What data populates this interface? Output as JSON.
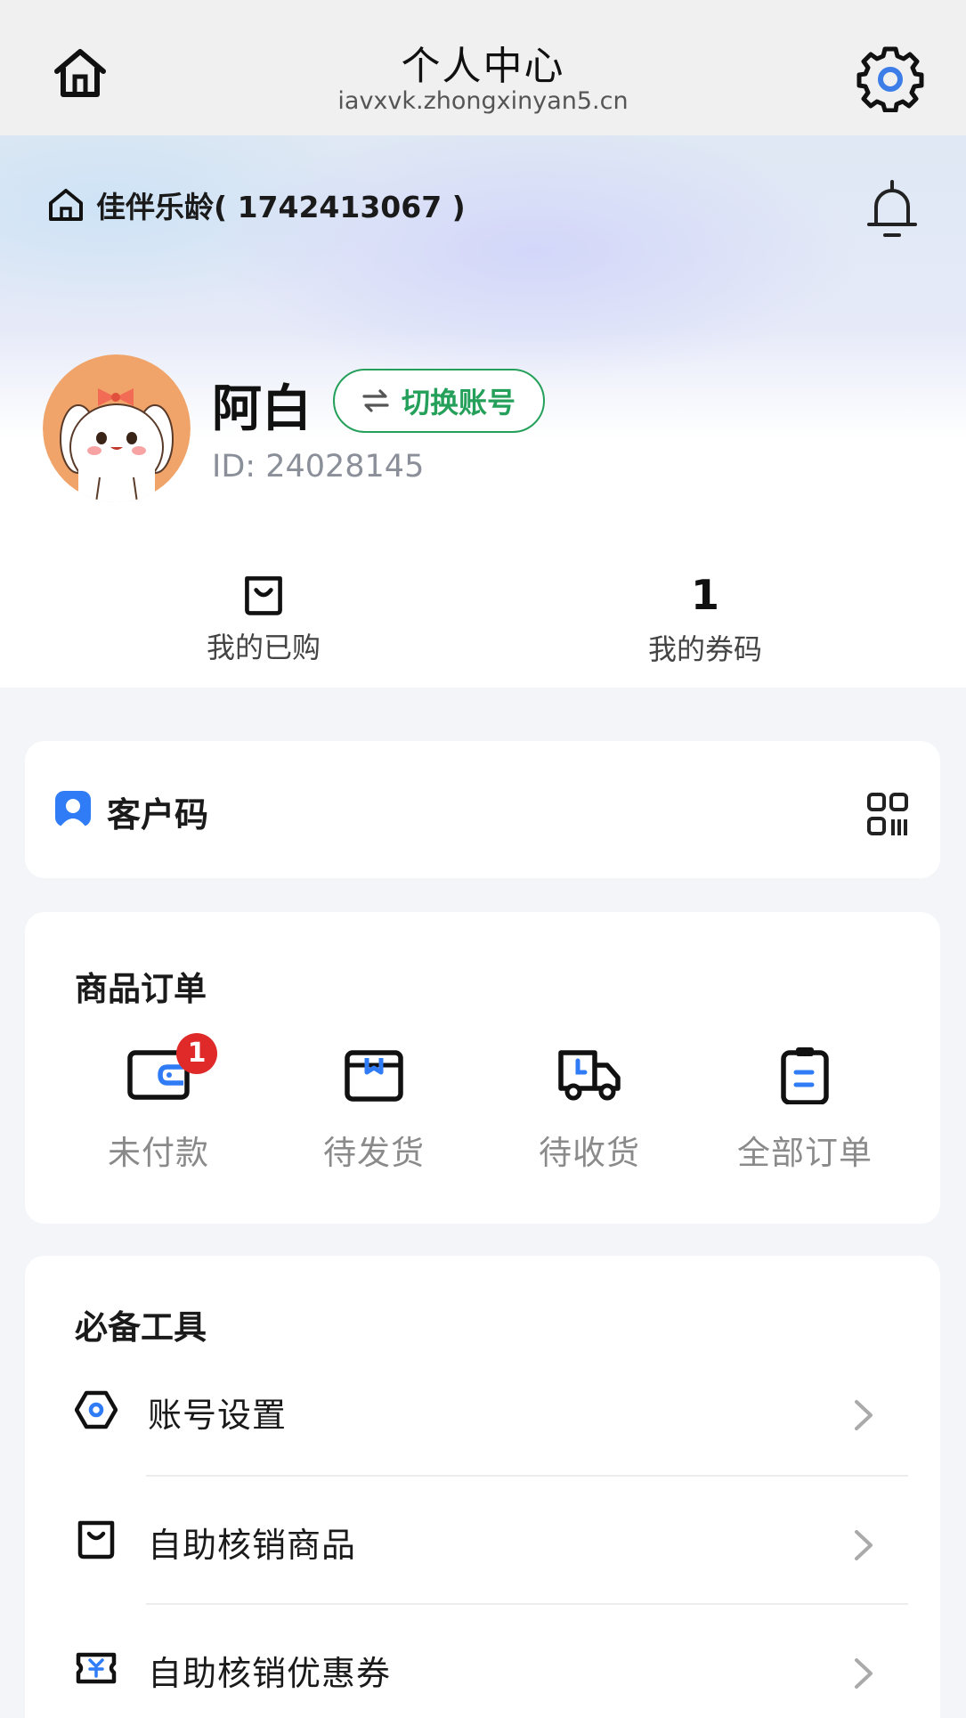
{
  "topbar": {
    "title": "个人中心",
    "url": "iavxvk.zhongxinyan5.cn",
    "home_icon": "home-icon",
    "settings_icon": "gear-icon"
  },
  "store": {
    "name": "佳伴乐龄( 1742413067 )",
    "store_icon": "store-icon",
    "bell_icon": "bell-icon"
  },
  "user": {
    "name": "阿白",
    "switch_label": "切换账号",
    "id_text": "ID: 24028145",
    "avatar": "cartoon-puppy-avatar"
  },
  "stats": {
    "purchased_label": "我的已购",
    "purchased_icon": "bag-icon",
    "coupons_value": "1",
    "coupons_label": "我的券码"
  },
  "customer_code": {
    "label": "客户码",
    "icon": "user-badge-icon",
    "qr_icon": "qr-code-icon"
  },
  "orders": {
    "title": "商品订单",
    "items": [
      {
        "label": "未付款",
        "icon": "wallet-icon",
        "badge": "1"
      },
      {
        "label": "待发货",
        "icon": "package-icon"
      },
      {
        "label": "待收货",
        "icon": "truck-icon"
      },
      {
        "label": "全部订单",
        "icon": "clipboard-icon"
      }
    ]
  },
  "tools": {
    "title": "必备工具",
    "items": [
      {
        "label": "账号设置",
        "icon": "hexagon-settings-icon"
      },
      {
        "label": "自助核销商品",
        "icon": "bag-icon"
      },
      {
        "label": "自助核销优惠券",
        "icon": "coupon-icon"
      }
    ]
  },
  "colors": {
    "accent_green": "#25a05a",
    "accent_blue": "#2f7cf6",
    "badge_red": "#e02a2a",
    "page_bg": "#f3f5f9"
  }
}
